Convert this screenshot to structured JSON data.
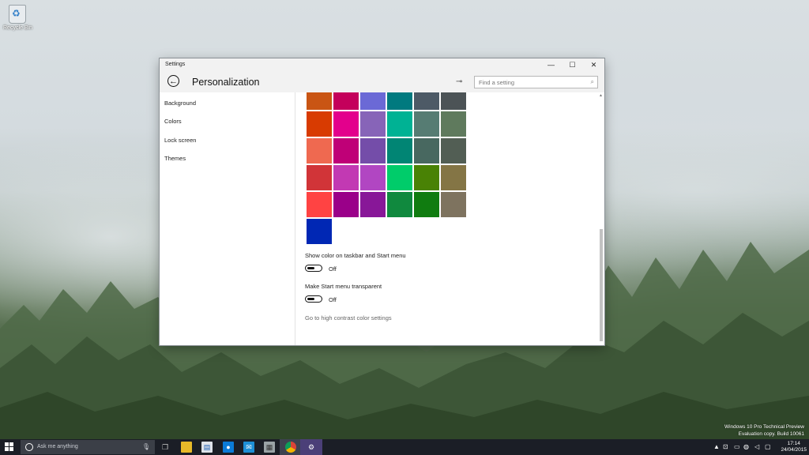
{
  "desktop": {
    "recycle_bin_label": "Recycle Bin",
    "watermark_line1": "Windows 10 Pro Technical Preview",
    "watermark_line2": "Evaluation copy. Build 10061"
  },
  "window": {
    "title": "Settings",
    "minimize_icon": "minimize-icon",
    "maximize_icon": "maximize-icon",
    "close_icon": "close-icon",
    "page_title": "Personalization",
    "search_placeholder": "Find a setting"
  },
  "nav": {
    "items": [
      {
        "label": "Background"
      },
      {
        "label": "Colors"
      },
      {
        "label": "Lock screen"
      },
      {
        "label": "Themes"
      }
    ]
  },
  "colors": {
    "swatches": [
      [
        "#c95514",
        "#c4005b",
        "#6b69d6",
        "#017a7f",
        "#4d5a66",
        "#4c5356"
      ],
      [
        "#d83b01",
        "#e3008c",
        "#8764b8",
        "#00b294",
        "#567c73",
        "#5f7a5d"
      ],
      [
        "#ef6950",
        "#bf0077",
        "#744da9",
        "#018574",
        "#486860",
        "#525e54"
      ],
      [
        "#d13438",
        "#c239b3",
        "#b146c2",
        "#00cc6a",
        "#498205",
        "#847545"
      ],
      [
        "#ff4343",
        "#9a0089",
        "#881798",
        "#10893e",
        "#107c10",
        "#7e735f"
      ],
      [
        "#0027b4"
      ]
    ],
    "taskbar_color_label": "Show color on taskbar and Start menu",
    "taskbar_color_state": "Off",
    "transparent_label": "Make Start menu transparent",
    "transparent_state": "Off",
    "high_contrast_link": "Go to high contrast color settings"
  },
  "taskbar": {
    "search_placeholder": "Ask me anything",
    "time": "17:14",
    "date": "24/04/2015",
    "apps": [
      "task-view-icon",
      "file-explorer-icon",
      "store-icon",
      "outlook-icon",
      "mail-icon",
      "photos-icon",
      "chrome-icon",
      "settings-icon"
    ]
  }
}
